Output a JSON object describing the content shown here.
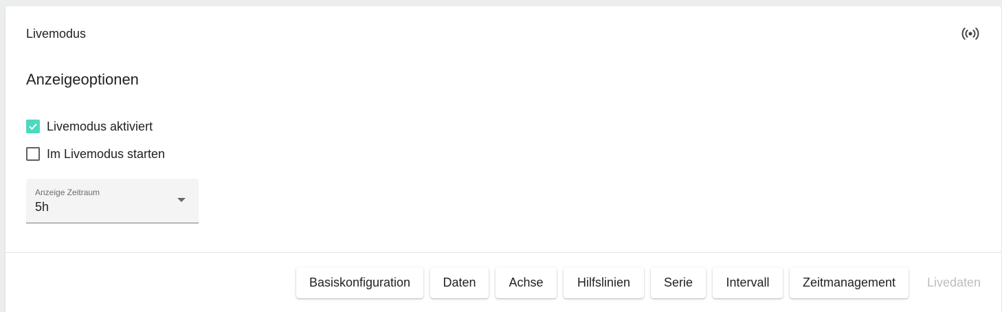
{
  "card": {
    "title": "Livemodus",
    "live_icon": "broadcast-icon"
  },
  "section": {
    "title": "Anzeigeoptionen"
  },
  "options": [
    {
      "label": "Livemodus aktiviert",
      "checked": true
    },
    {
      "label": "Im Livemodus starten",
      "checked": false
    }
  ],
  "select": {
    "label": "Anzeige Zeitraum",
    "value": "5h"
  },
  "tabs": [
    {
      "label": "Basiskonfiguration",
      "enabled": true
    },
    {
      "label": "Daten",
      "enabled": true
    },
    {
      "label": "Achse",
      "enabled": true
    },
    {
      "label": "Hilfslinien",
      "enabled": true
    },
    {
      "label": "Serie",
      "enabled": true
    },
    {
      "label": "Intervall",
      "enabled": true
    },
    {
      "label": "Zeitmanagement",
      "enabled": true
    },
    {
      "label": "Livedaten",
      "enabled": false
    }
  ],
  "colors": {
    "accent": "#4dd9c0",
    "disabled_text": "#bdbdbd"
  }
}
